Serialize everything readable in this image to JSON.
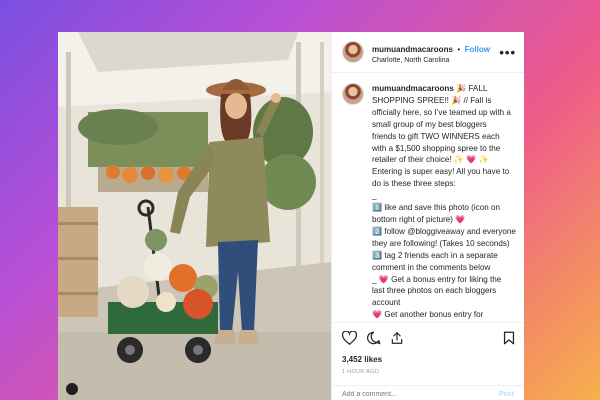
{
  "post": {
    "username": "mumuandmacaroons",
    "separator": "•",
    "follow_label": "Follow",
    "location": "Charlotte, North Carolina",
    "more_label": "•••"
  },
  "caption": {
    "username": "mumuandmacaroons",
    "lines": [
      "🎉  FALL",
      "SHOPPING SPREE!! 🎉  // Fall is",
      "officially here, so I’ve teamed up with a",
      "small group of my best bloggers",
      "friends to gift TWO WINNERS each",
      "with a $1,500 shopping spree to the",
      "retailer of their choice! ✨ 💗 ✨",
      "Entering is super easy! All you have to",
      "do is these three steps:",
      "_",
      "1️⃣  like and save this photo (icon on",
      "bottom right of picture) 💗",
      "2️⃣  follow @bloggiveaway and everyone",
      "they are following! (Takes 10 seconds)",
      "3️⃣  tag 2 friends each in a separate",
      "comment in the comments below",
      "_ 💗  Get a bonus entry for liking the",
      "last three photos on each bloggers",
      "account",
      "💗  Get another bonus entry for"
    ]
  },
  "engagement": {
    "likes": "3,452 likes",
    "time": "1 HOUR AGO"
  },
  "comment": {
    "placeholder": "Add a comment...",
    "post_label": "Post"
  },
  "icons": {
    "like": "heart-icon",
    "comment": "comment-icon",
    "share": "share-icon",
    "save": "bookmark-icon"
  },
  "colors": {
    "follow": "#3897f0",
    "text": "#262626",
    "muted": "#999999",
    "post_disabled": "#b2dffc"
  }
}
